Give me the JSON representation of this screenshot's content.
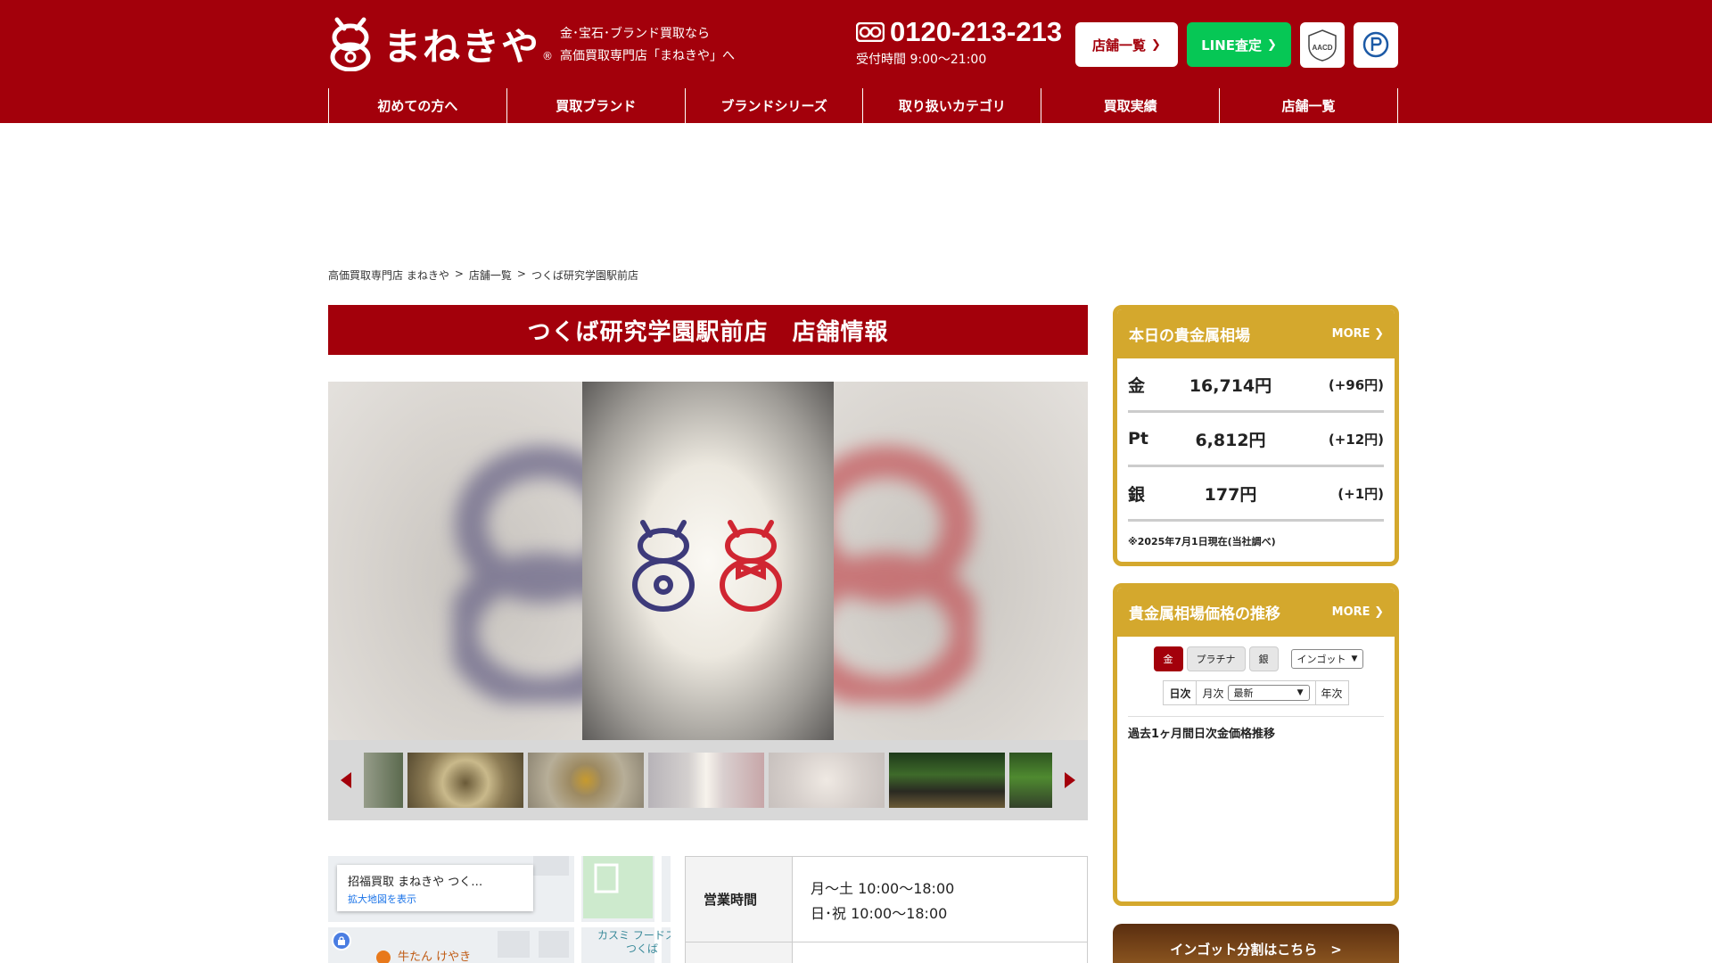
{
  "header": {
    "logo_text": "まねきや",
    "logo_reg": "®",
    "tagline_1": "金･宝石･ブランド買取なら",
    "tagline_2": "高価買取専門店「まねきや」へ",
    "phone": "0120-213-213",
    "hours": "受付時間 9:00〜21:00",
    "shop_button": "店舗一覧",
    "line_button": "LINE査定",
    "badge_aacd": "AACD",
    "colors": {
      "brand": "#a3000b",
      "line": "#06c755",
      "gold": "#d4a82d"
    }
  },
  "nav": [
    "初めての方へ",
    "買取ブランド",
    "ブランドシリーズ",
    "取り扱いカテゴリ",
    "買取実績",
    "店舗一覧"
  ],
  "breadcrumb": [
    "高価買取専門店 まねきや",
    ">",
    "店舗一覧",
    ">",
    "つくば研究学園駅前店"
  ],
  "main": {
    "title": "つくば研究学園駅前店　店舗情報",
    "map_name": "招福買取 まねきや つく…",
    "map_link": "拡大地図を表示",
    "map_label_1": "カスミ フードス",
    "map_label_2": "つくば",
    "map_label_3": "牛たん けやき",
    "hours_head": "営業時間",
    "hours_1": "月〜土 10:00〜18:00",
    "hours_2": "日･祝 10:00〜18:00"
  },
  "sidebar": {
    "rates_title": "本日の貴金属相場",
    "more": "MORE",
    "rates": [
      {
        "metal": "金",
        "price": "16,714円",
        "diff": "(+96円)"
      },
      {
        "metal": "Pt",
        "price": "6,812円",
        "diff": "(+12円)"
      },
      {
        "metal": "銀",
        "price": "177円",
        "diff": "(+1円)"
      }
    ],
    "rates_note": "※2025年7月1日現在(当社調べ)",
    "trend_title": "貴金属相場価格の推移",
    "tabs": [
      "金",
      "プラチナ",
      "銀"
    ],
    "ingot_select": "インゴット",
    "period_daily": "日次",
    "period_monthly": "月次",
    "period_select": "最新",
    "period_yearly": "年次",
    "chart_title": "過去1ヶ月間日次金価格推移",
    "ingot_banner": "インゴット分割はこちら　>"
  },
  "icons": {
    "logo": "maneki-neko-logo-icon",
    "phone": "free-dial-icon",
    "chevron": "chevron-right-icon",
    "arrow_left": "arrow-left-icon",
    "arrow_right": "arrow-right-icon",
    "map_pin": "lock-pin-icon"
  }
}
